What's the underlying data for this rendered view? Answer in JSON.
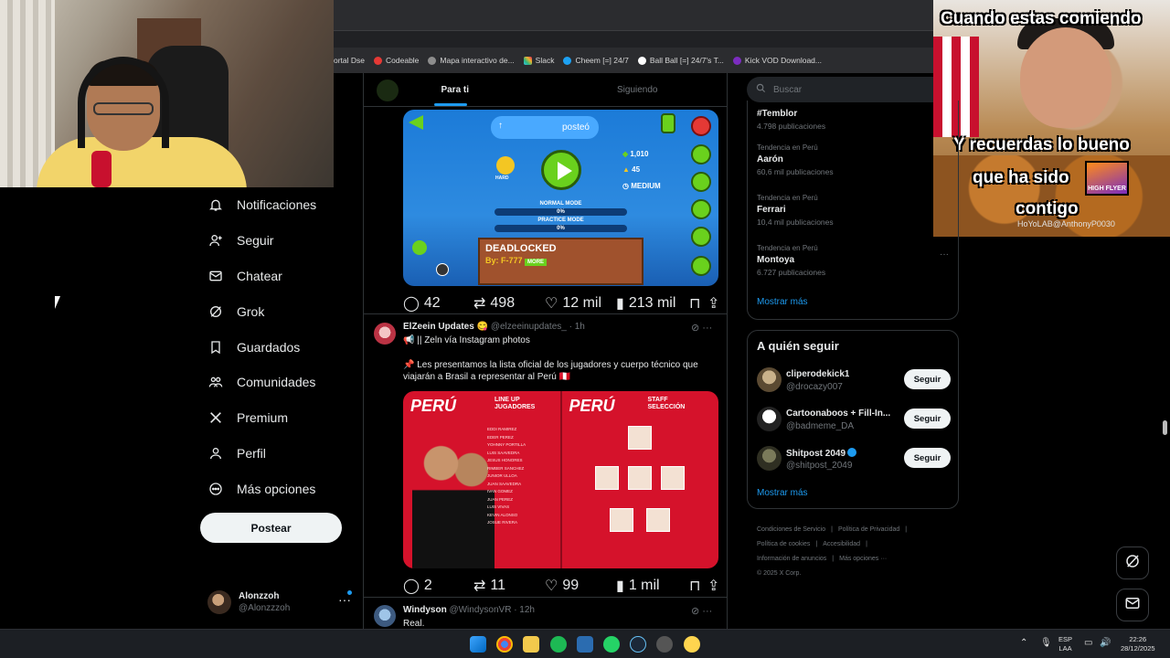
{
  "browser": {
    "bookmarks": [
      {
        "label": "ortal Dse",
        "color": "#2b2c2f"
      },
      {
        "label": "Codeable",
        "color": "#e53935"
      },
      {
        "label": "Mapa interactivo de...",
        "color": "#8d8d8d"
      },
      {
        "label": "Slack",
        "color": "#4a154b"
      },
      {
        "label": "Cheem [=] 24/7",
        "color": "#1da1f2"
      },
      {
        "label": "Ball Ball [=] 24/7's T...",
        "color": "#ffffff"
      },
      {
        "label": "Kick VOD Download...",
        "color": "#7b2cbf"
      }
    ]
  },
  "meme": {
    "line1": "Cuando estas comiendo",
    "line2": "Y recuerdas lo bueno",
    "line3": "que ha sido",
    "line4": "contigo",
    "sticker": "HIGH FLYER",
    "watermark": "HoYoLAB@AnthonyP0030"
  },
  "nav": {
    "items": [
      {
        "label": "Notificaciones",
        "icon": "bell-icon"
      },
      {
        "label": "Seguir",
        "icon": "person-plus-icon"
      },
      {
        "label": "Chatear",
        "icon": "mail-icon"
      },
      {
        "label": "Grok",
        "icon": "grok-icon"
      },
      {
        "label": "Guardados",
        "icon": "bookmark-icon"
      },
      {
        "label": "Comunidades",
        "icon": "people-icon"
      },
      {
        "label": "Premium",
        "icon": "x-logo-icon"
      },
      {
        "label": "Perfil",
        "icon": "person-icon"
      },
      {
        "label": "Más opciones",
        "icon": "more-circle-icon"
      }
    ],
    "post_button": "Postear",
    "user": {
      "name": "Alonzzoh",
      "handle": "@Alonzzzoh"
    }
  },
  "feed": {
    "tabs": [
      "Para ti",
      "Siguiendo"
    ],
    "post1": {
      "media": {
        "posted_label": "posteó",
        "likes": "1,010",
        "downloads": "45",
        "difficulty": "MEDIUM",
        "difficulty_face": "HARD",
        "normal_mode": "NORMAL MODE",
        "normal_pct": "0%",
        "practice_mode": "PRACTICE MODE",
        "practice_pct": "0%",
        "level_name": "DEADLOCKED",
        "level_by": "By: F-777",
        "more": "MORE"
      },
      "replies": "42",
      "reposts": "498",
      "likes": "12 mil",
      "views": "213 mil"
    },
    "post2": {
      "name": "ElZeein Updates",
      "handle": "@elzeeinupdates_",
      "time": "· 1h",
      "line1": "📢 || Zeln vía Instagram photos",
      "line2": "📌 Les presentamos la lista oficial de los jugadores y cuerpo técnico que viajarán a Brasil a representar al Perú 🇵🇪",
      "media_left_title": "PERÚ",
      "media_left_sub": "LINE UP\nJUGADORES",
      "media_right_title": "PERÚ",
      "media_right_sub": "STAFF\nSELECCIÓN",
      "players": [
        "EDDI RAMIREZ",
        "EDER PEREZ",
        "YOHNNY PORTILLA",
        "LUIS SAAVEDRA",
        "JESUS HONORES",
        "RIMBER SANCHEZ",
        "JUNIOR ULLOA",
        "JUAN SAAVEDRA",
        "IVAN GOMEZ",
        "JUAN PEREZ",
        "LUIS VIVAS",
        "KEVIN ALONSO",
        "JOSUE RIVERA"
      ],
      "replies": "2",
      "reposts": "11",
      "likes": "99",
      "views": "1 mil"
    },
    "post3": {
      "name": "Windyson",
      "handle": "@WindysonVR",
      "time": "· 12h",
      "text": "Real."
    }
  },
  "right": {
    "search_placeholder": "Buscar",
    "trends": [
      {
        "context": "",
        "title": "#Temblor",
        "count": "4.798 publicaciones"
      },
      {
        "context": "Tendencia en Perú",
        "title": "Aarón",
        "count": "60,6 mil publicaciones"
      },
      {
        "context": "Tendencia en Perú",
        "title": "Ferrari",
        "count": "10,4 mil publicaciones"
      },
      {
        "context": "Tendencia en Perú",
        "title": "Montoya",
        "count": "6.727 publicaciones"
      }
    ],
    "trends_more": "Mostrar más",
    "follow_title": "A quién seguir",
    "follow": [
      {
        "name": "cliperodekick1",
        "handle": "@drocazy007",
        "button": "Seguir",
        "verified": false
      },
      {
        "name": "Cartoonaboos + Fill-In...",
        "handle": "@badmeme_DA",
        "button": "Seguir",
        "verified": false
      },
      {
        "name": "Shitpost 2049",
        "handle": "@shitpost_2049",
        "button": "Seguir",
        "verified": true
      }
    ],
    "follow_more": "Mostrar más",
    "footer": [
      "Condiciones de Servicio",
      "|",
      "Política de Privacidad",
      "|",
      "Política de cookies",
      "|",
      "Accesibilidad",
      "|",
      "Información de anuncios",
      "|",
      "Más opciones ···",
      "© 2025 X Corp."
    ]
  },
  "taskbar": {
    "lang1": "ESP",
    "lang2": "LAA",
    "time": "22:26",
    "date": "28/12/2025"
  },
  "colors": {
    "accent": "#1d9bf0",
    "background": "#000000",
    "border": "#2f3336"
  }
}
